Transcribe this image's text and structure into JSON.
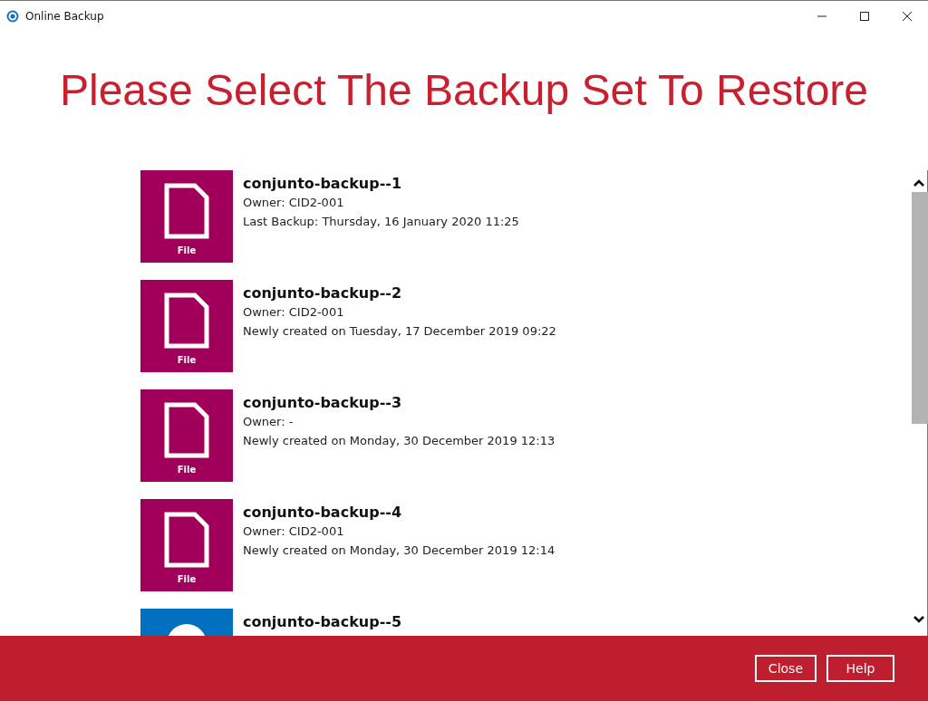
{
  "window": {
    "title": "Online Backup"
  },
  "heading": "Please Select The Backup Set To Restore",
  "backup_sets": [
    {
      "name": "conjunto-backup--1",
      "color": "#a0005a",
      "tile_label": "File",
      "owner": "Owner: CID2-001",
      "status": "Last Backup: Thursday, 16 January 2020 11:25"
    },
    {
      "name": "conjunto-backup--2",
      "color": "#a0005a",
      "tile_label": "File",
      "owner": "Owner: CID2-001",
      "status": "Newly created on Tuesday, 17 December 2019 09:22"
    },
    {
      "name": "conjunto-backup--3",
      "color": "#a0005a",
      "tile_label": "File",
      "owner": "Owner: -",
      "status": "Newly created on Monday, 30 December 2019 12:13"
    },
    {
      "name": "conjunto-backup--4",
      "color": "#a0005a",
      "tile_label": "File",
      "owner": "Owner: CID2-001",
      "status": "Newly created on Monday, 30 December 2019 12:14"
    },
    {
      "name": "conjunto-backup--5",
      "color": "#0070c0"
    }
  ],
  "buttons": [
    "Close",
    "Help"
  ]
}
